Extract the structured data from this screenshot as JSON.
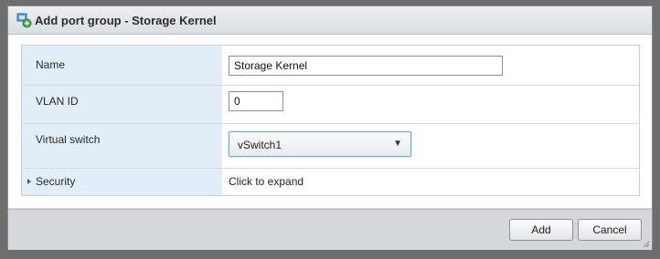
{
  "dialog": {
    "title": "Add port group - Storage Kernel",
    "title_icon": "port-group-icon"
  },
  "form": {
    "name": {
      "label": "Name",
      "value": "Storage Kernel"
    },
    "vlan": {
      "label": "VLAN ID",
      "value": "0"
    },
    "virtual_switch": {
      "label": "Virtual switch",
      "selected": "vSwitch1",
      "arrow": "▼"
    },
    "security": {
      "label": "Security",
      "value": "Click to expand",
      "icon": "expand-arrow-icon"
    }
  },
  "footer": {
    "add_label": "Add",
    "cancel_label": "Cancel"
  },
  "colors": {
    "label_background": "#e2eef7",
    "select_focus_border": "#6fa7d9",
    "dialog_chrome": "#d4d8dc"
  }
}
